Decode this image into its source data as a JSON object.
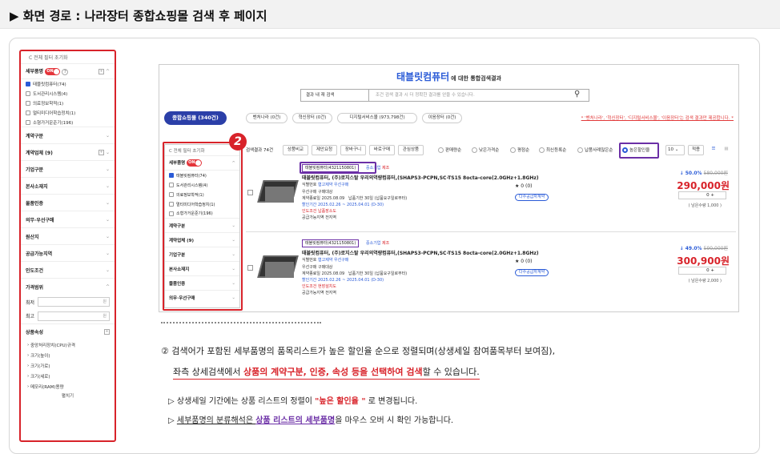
{
  "header": {
    "title": "▶ 화면 경로 : 나라장터 종합쇼핑몰 검색 후 페이지"
  },
  "colors": {
    "accent": "#d8232a",
    "primary": "#2b3fa8",
    "blue": "#2a5bd7",
    "purple": "#6b2fa6"
  },
  "sidebar": {
    "reset": "C 전체 필터 초기화",
    "sec1": "세부품명",
    "toggle": "ON",
    "items": [
      "태블릿컴퓨터(74)",
      "도서관리시스템(4)",
      "의료정보학적(1)",
      "멀티미디어학습정치(1)",
      "소형가거운준기(196)"
    ],
    "groups": [
      "계약구분",
      "계약업체 (9)",
      "기업구분",
      "본사소재지",
      "물품인증",
      "의무·우선구매",
      "원산지",
      "공급가능지역",
      "인도조건",
      "가격범위"
    ],
    "min_label": "최저",
    "max_label": "최고",
    "won": "원",
    "attr": "상품속성",
    "attrs": [
      "중앙처리장치(CPU)규격",
      "크기(높이)",
      "크기(가로)",
      "크기(세로)",
      "메모리(RAM)용량"
    ],
    "more": "펼치기"
  },
  "shot": {
    "keyword": "태블릿컴퓨터",
    "suffix": "에 대한 통합검색결과",
    "scope": "결과 내 재 검색",
    "placeholder": "조건 검색 결과 시 더 정확한 결과를 얻을 수 있습니다.",
    "tab_main": "종합쇼핑몰 (340건)",
    "tabs": [
      "벤처나라 (0건)",
      "혁신장터 (0건)",
      "디지털서비스몰 (973,798건)",
      "이음장터 (0건)"
    ],
    "notice": "* '벤처나라', '혁신장터', '디지털서비스몰', '이음장터'는 검색 결과만 제공합니다. *",
    "inner_reset": "C 전체 필터 초기화",
    "inner_items": [
      "태블릿컴퓨터(74)",
      "도서관리시스템(4)",
      "의료정보학적(1)",
      "멀티미디어학습정치(1)",
      "소형가거운준기(196)"
    ],
    "inner_groups": [
      "계약구분",
      "계약업체 (9)",
      "기업구분",
      "본사소재지",
      "물품인증",
      "의무·우선구매"
    ],
    "count": "검색결과 74건",
    "buttons": [
      "상품비교",
      "제안요청",
      "장바구니",
      "바로구매",
      "관심상품"
    ],
    "sorts": [
      "판매량순",
      "낮은가격순",
      "평점순",
      "최신등록순",
      "납품사례많은순",
      "높은할인율"
    ],
    "perpage": "10",
    "apply": "적용",
    "badge": "2",
    "products": [
      {
        "cat": "태블릿컴퓨터(4321150801)",
        "grade": "중소기업",
        "made": "제조",
        "title": "태블릿컴퓨터, (주)로지스탈 우리의역량컴퓨터,(SHAPS3-PCPN,SC-TS15 8octa-core(2.0GHz+1.8GHz)",
        "idno": "식별번호",
        "tags": [
          "협고제약",
          "우선구매"
        ],
        "l1": "우선구매 구매대상",
        "l2": "납품기한 30일 (납품요구일로부터)",
        "l3": "할인기간 2025.02.26 ~ 2025.04.01 (D-30)",
        "l4": "인도조건 납품장소도",
        "l5": "공급가능지역 전지역",
        "reg": "계약종료일 2025.08.09",
        "rating": "★ 0 (0)",
        "pill": "다수공급자계약",
        "disc": "50.0%",
        "orig": "580,000원",
        "price": "290,000원",
        "qty": "0",
        "rem": "( 남은수량 1,000 )"
      },
      {
        "cat": "태블릿컴퓨터(4321150801)",
        "grade": "중소기업",
        "made": "제조",
        "title": "태블릿컴퓨터, (주)로지스탈 우리의역량컴퓨터,(SHAPS3-PCPN,SC-TS15 8octa-core(2.0GHz+1.8GHz)",
        "idno": "식별번호",
        "tags": [
          "협고제약",
          "우선구매"
        ],
        "l1": "우선구매 구매대상",
        "l2": "납품기한 30일 (납품요구일로부터)",
        "l3": "할인기간 2025.02.26 ~ 2025.04.01 (D-30)",
        "l4": "인도조건 현장설치도",
        "l5": "공급가능지역 전지역",
        "reg": "계약종료일 2025.08.09",
        "rating": "★ 0 (0)",
        "pill": "다수공급자계약",
        "disc": "49.0%",
        "orig": "590,000원",
        "price": "300,900원",
        "qty": "0",
        "rem": "( 남은수량 2,000 )"
      }
    ]
  },
  "desc": {
    "p1": "② 검색어가 포함된 세부품명의 품목리스트가 높은 할인율 순으로 정렬되며(상생세일 참여품목부터 보여짐),",
    "p2a": "좌측 상세검색에서 ",
    "p2b": "상품의 계약구분, 인증, 속성 등을 선택하여 검색",
    "p2c": "할 수 있습니다.",
    "b1a": "▷ 상생세일 기간에는 상품 리스트의 정렬이 ",
    "b1b": "\"높은 할인율 \"",
    "b1c": " 로 변경됩니다.",
    "b2a": "▷ ",
    "b2b": "세부품명의 분류해석은 ",
    "b2c": "상품 리스트의 세부품명",
    "b2d": "을 마우스 오버 시 확인 가능합니다."
  }
}
